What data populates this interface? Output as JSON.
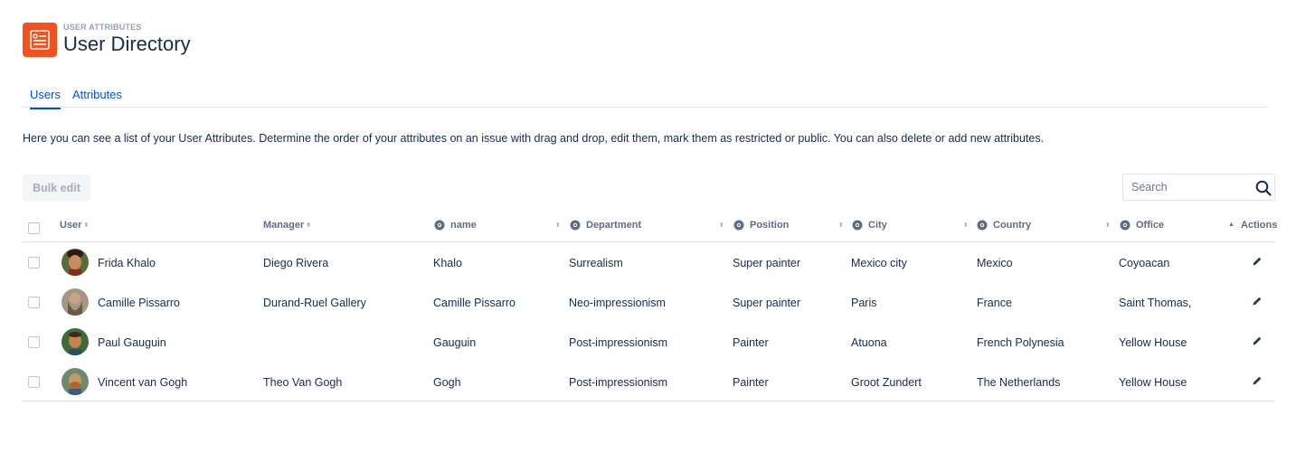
{
  "header": {
    "eyebrow": "USER ATTRIBUTES",
    "title": "User Directory",
    "icon": "user-list-icon",
    "icon_color": "#f4511e"
  },
  "tabs": [
    {
      "label": "Users",
      "active": true
    },
    {
      "label": "Attributes",
      "active": false
    }
  ],
  "description": "Here you can see a list of your User Attributes. Determine the order of your attributes on an issue with drag and drop, edit them, mark them as restricted or public. You can also delete or add new attributes.",
  "toolbar": {
    "bulk_edit_label": "Bulk edit",
    "search_placeholder": "Search"
  },
  "table": {
    "columns": {
      "user": "User",
      "manager": "Manager",
      "name": "name",
      "department": "Department",
      "position": "Position",
      "city": "City",
      "country": "Country",
      "office": "Office",
      "actions": "Actions"
    },
    "rows": [
      {
        "user": "Frida Khalo",
        "manager": "Diego Rivera",
        "name": "Khalo",
        "department": "Surrealism",
        "position": "Super painter",
        "city": "Mexico city",
        "country": "Mexico",
        "office": "Coyoacan"
      },
      {
        "user": "Camille Pissarro",
        "manager": "Durand-Ruel Gallery",
        "name": "Camille Pissarro",
        "department": "Neo-impressionism",
        "position": "Super painter",
        "city": "Paris",
        "country": "France",
        "office": "Saint Thomas,"
      },
      {
        "user": "Paul Gauguin",
        "manager": "",
        "name": "Gauguin",
        "department": "Post-impressionism",
        "position": "Painter",
        "city": "Atuona",
        "country": "French Polynesia",
        "office": "Yellow House"
      },
      {
        "user": "Vincent van Gogh",
        "manager": "Theo Van Gogh",
        "name": "Gogh",
        "department": "Post-impressionism",
        "position": "Painter",
        "city": "Groot Zundert",
        "country": "The Netherlands",
        "office": "Yellow House"
      }
    ]
  }
}
